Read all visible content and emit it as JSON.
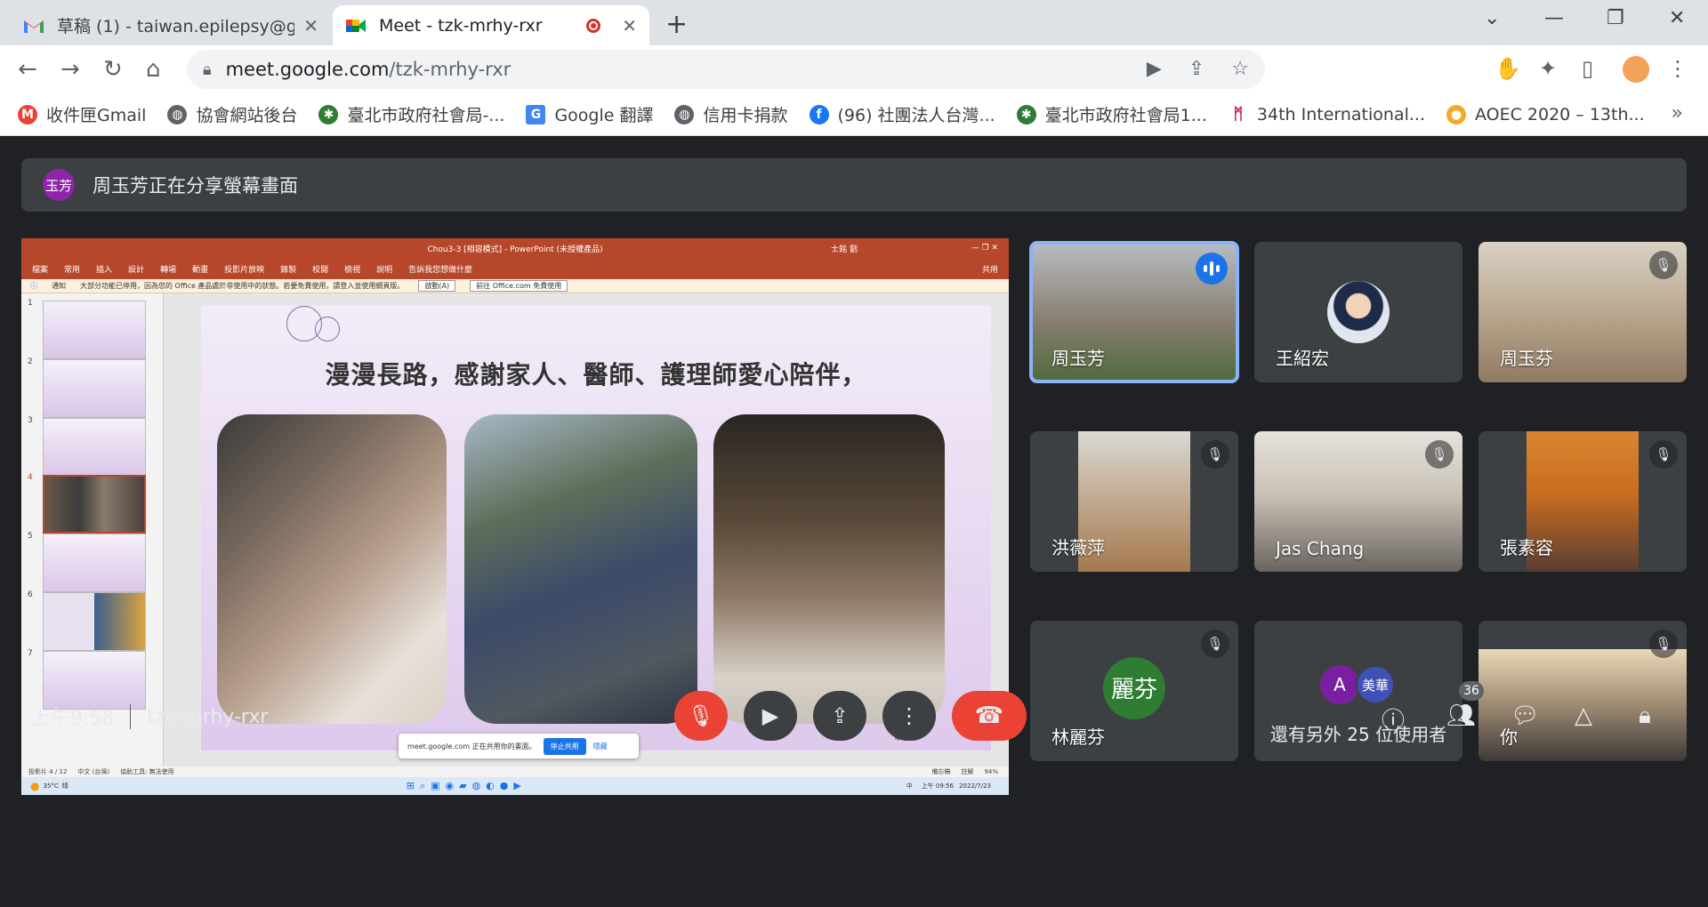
{
  "tabs": [
    {
      "title": "草稿 (1) - taiwan.epilepsy@gma",
      "favicon": "gmail-icon"
    },
    {
      "title": "Meet - tzk-mrhy-rxr",
      "favicon": "meet-icon",
      "recording": true
    }
  ],
  "toolbar": {
    "url_host": "meet.google.com",
    "url_path": "/tzk-mrhy-rxr"
  },
  "bookmarks": [
    {
      "label": "收件匣Gmail",
      "icon": "gmail-icon",
      "color": "#ea4335"
    },
    {
      "label": "協會網站後台",
      "icon": "globe-icon",
      "color": "#5f6368"
    },
    {
      "label": "臺北市政府社會局-...",
      "icon": "taipei-gov-icon",
      "color": "#2e7d32"
    },
    {
      "label": "Google 翻譯",
      "icon": "translate-icon",
      "color": "#4285f4"
    },
    {
      "label": "信用卡捐款",
      "icon": "globe-icon",
      "color": "#5f6368"
    },
    {
      "label": "(96) 社團法人台灣...",
      "icon": "facebook-icon",
      "color": "#1877f2"
    },
    {
      "label": "臺北市政府社會局1...",
      "icon": "taipei-gov-icon",
      "color": "#2e7d32"
    },
    {
      "label": "34th International...",
      "icon": "conference-icon",
      "color": "#c2185b"
    },
    {
      "label": "AOEC 2020 – 13th...",
      "icon": "aoec-icon",
      "color": "#f9a825"
    }
  ],
  "banner": {
    "avatar_text": "玉芳",
    "text": "周玉芳正在分享螢幕畫面"
  },
  "presentation": {
    "window_title": "Chou3-3 [相容模式] - PowerPoint (未授權產品)",
    "user": "士銘 劉",
    "share_label": "共用",
    "ribbon": [
      "檔案",
      "常用",
      "插入",
      "設計",
      "轉場",
      "動畫",
      "投影片放映",
      "錄製",
      "校閱",
      "檢視",
      "說明",
      "告訴我您想做什麼"
    ],
    "notice_label": "通知",
    "notice": "大部分功能已停用，因為您的 Office 產品處於非使用中的狀態。若要免費使用，請登入並使用網頁版。",
    "notice_btn1": "啟動(A)",
    "notice_btn2": "前往 Office.com 免費使用",
    "slide_heading": "漫漫長路，感謝家人、醫師、護理師愛心陪伴，",
    "slide_number": "4",
    "thumb_numbers": [
      "1",
      "2",
      "3",
      "4",
      "5",
      "6",
      "7"
    ],
    "selected_thumb": 4,
    "status_left": "投影片 4 / 12",
    "status_lang": "中文 (台灣)",
    "status_access": "協助工具: 無法使用",
    "status_notes": "備忘稿",
    "status_comments": "註解",
    "zoom": "94%",
    "share_chip_text": "meet.google.com 正在共用你的畫面。",
    "share_chip_stop": "停止共用",
    "share_chip_hide": "隱藏",
    "weather_temp": "35°C",
    "weather_desc": "晴",
    "taskbar_ime": "中",
    "taskbar_time": "上午 09:56",
    "taskbar_date": "2022/7/23"
  },
  "participants": [
    {
      "name": "周玉芳",
      "speaking": true,
      "muted": false,
      "bg": "#8a7f73"
    },
    {
      "name": "王紹宏",
      "speaking": false,
      "muted": false,
      "avatar_photo": true,
      "bg": "#3c4043"
    },
    {
      "name": "周玉芬",
      "speaking": false,
      "muted": true,
      "bg": "#b9a88f"
    },
    {
      "name": "洪薇萍",
      "speaking": false,
      "muted": true,
      "bg": "#a5784f"
    },
    {
      "name": "Jas Chang",
      "speaking": false,
      "muted": true,
      "bg": "#c9c2b6"
    },
    {
      "name": "張素容",
      "speaking": false,
      "muted": true,
      "bg": "#c96c22"
    },
    {
      "name": "林麗芬",
      "speaking": false,
      "muted": true,
      "letter": "麗芬",
      "letter_color": "#2e7d32"
    },
    {
      "others_text": "還有另外 25 位使用者",
      "mini_avatars": [
        {
          "text": "A",
          "color": "#7b1fa2"
        },
        {
          "text": "美華",
          "color": "#3f51b5"
        }
      ]
    },
    {
      "name": "你",
      "speaking": false,
      "muted": true,
      "bg": "#9d8a72"
    }
  ],
  "bottom": {
    "time": "上午9:58",
    "meeting_code": "tzk-mrhy-rxr",
    "people_count": "36"
  },
  "colors": {
    "meet_bg": "#202124",
    "tile_bg": "#3c4043",
    "danger": "#ea4335",
    "ppt_accent": "#b7472a",
    "speaking_outline": "#8ab4f8"
  }
}
